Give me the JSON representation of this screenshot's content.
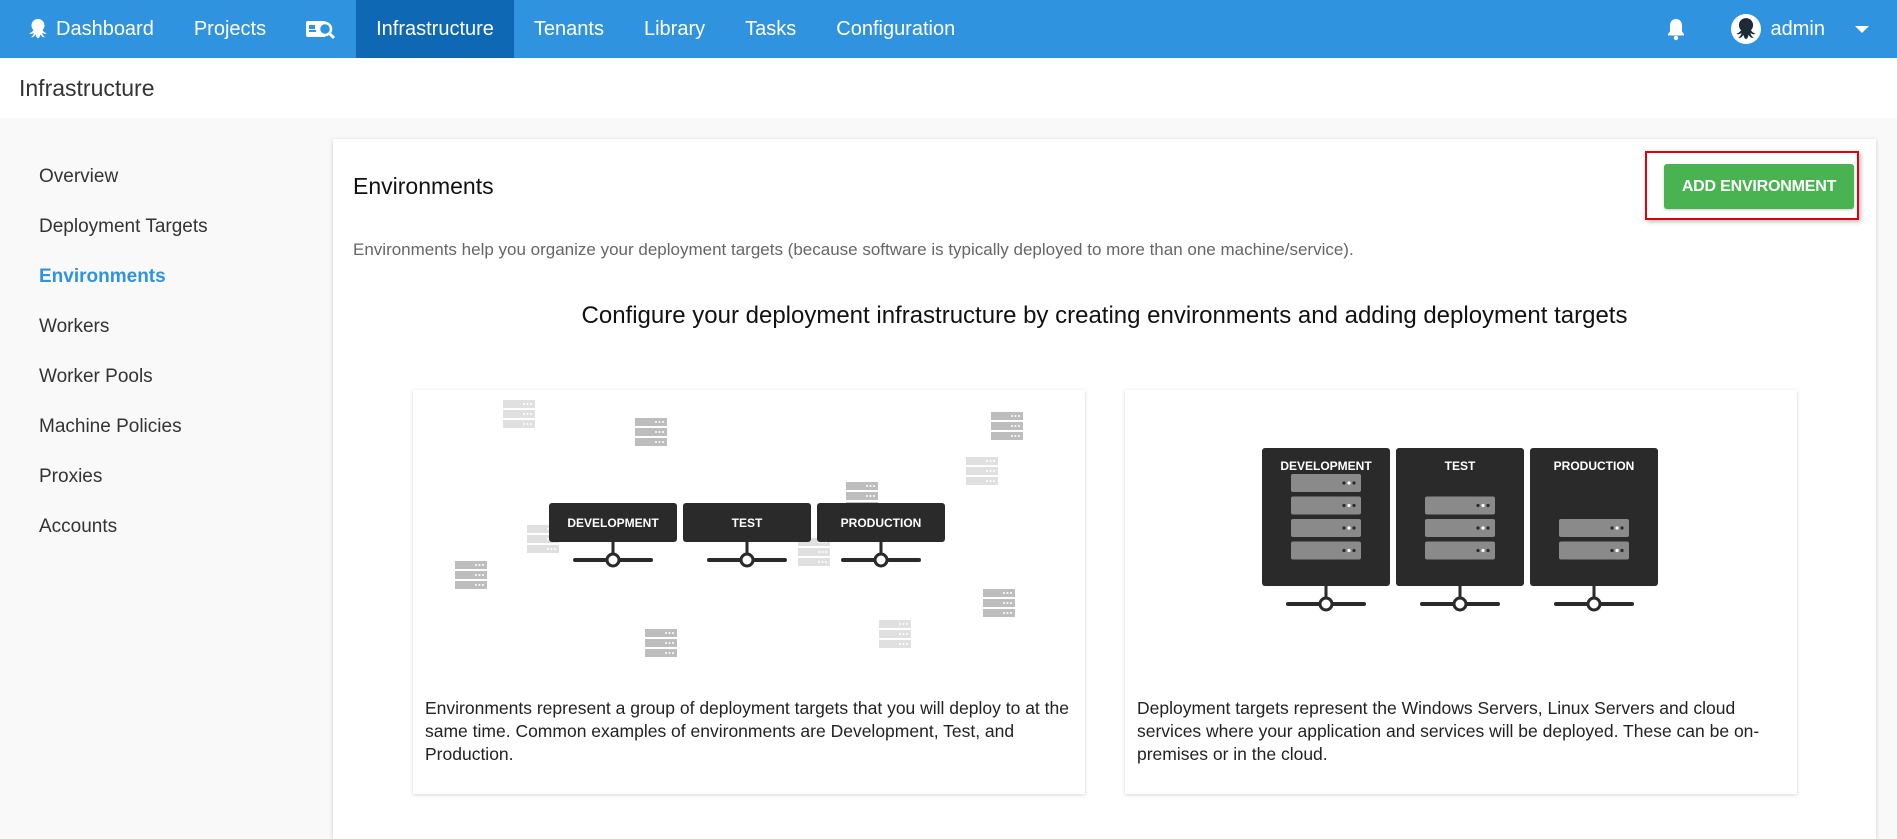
{
  "nav": {
    "items": [
      {
        "label": "Dashboard",
        "icon": "octopus-icon",
        "active": false
      },
      {
        "label": "Projects",
        "active": false
      },
      {
        "label": "",
        "icon": "search-card-icon",
        "active": false
      },
      {
        "label": "Infrastructure",
        "active": true
      },
      {
        "label": "Tenants",
        "active": false
      },
      {
        "label": "Library",
        "active": false
      },
      {
        "label": "Tasks",
        "active": false
      },
      {
        "label": "Configuration",
        "active": false
      }
    ],
    "user": "admin",
    "bell_icon": "bell-icon"
  },
  "page": {
    "title": "Infrastructure"
  },
  "sidebar": {
    "items": [
      {
        "label": "Overview"
      },
      {
        "label": "Deployment Targets"
      },
      {
        "label": "Environments",
        "active": true
      },
      {
        "label": "Workers"
      },
      {
        "label": "Worker Pools"
      },
      {
        "label": "Machine Policies"
      },
      {
        "label": "Proxies"
      },
      {
        "label": "Accounts"
      }
    ]
  },
  "main": {
    "title": "Environments",
    "add_button": "ADD ENVIRONMENT",
    "intro": "Environments help you organize your deployment targets (because software is typically deployed to more than one machine/service).",
    "headline": "Configure your deployment infrastructure by creating environments and adding deployment targets",
    "cards": [
      {
        "illustration": "environments-diagram",
        "env_labels": [
          "DEVELOPMENT",
          "TEST",
          "PRODUCTION"
        ],
        "text": "Environments represent a group of deployment targets that you will deploy to at the same time. Common examples of environments are Development, Test, and Production."
      },
      {
        "illustration": "deployment-targets-diagram",
        "env_labels": [
          "DEVELOPMENT",
          "TEST",
          "PRODUCTION"
        ],
        "server_counts": [
          4,
          3,
          2
        ],
        "text": "Deployment targets represent the Windows Servers, Linux Servers and cloud services where your application and services will be deployed. These can be on-premises or in the cloud."
      }
    ]
  },
  "colors": {
    "nav_bg": "#2f93e0",
    "nav_active": "#0f68b4",
    "accent": "#2f93e0",
    "button_green": "#48b350",
    "highlight_red": "#e0000e"
  }
}
